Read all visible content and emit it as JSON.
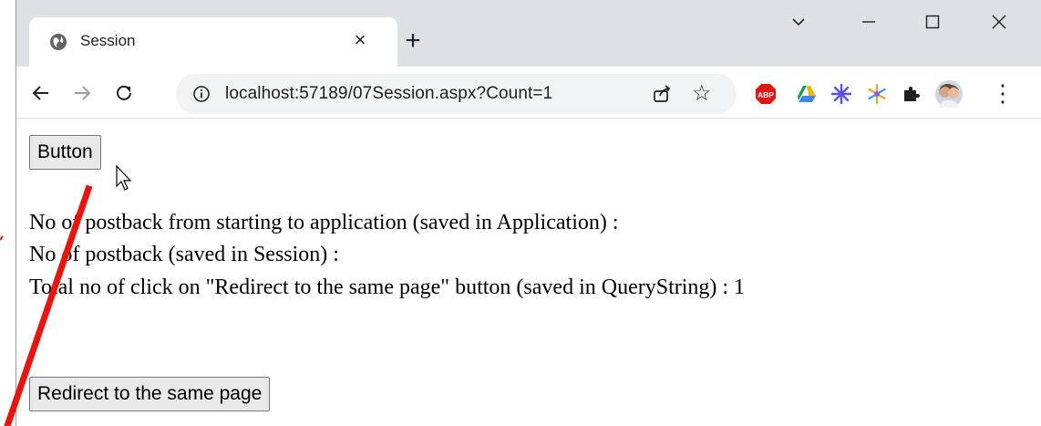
{
  "browser": {
    "tab_title": "Session",
    "tab_close": "×",
    "new_tab": "+",
    "url": "localhost:57189/07Session.aspx?Count=1",
    "controls": {
      "minimize": "–",
      "maximize": "☐",
      "close": "✕",
      "dropdown": "⌵"
    },
    "menu": "⋮",
    "extensions": [
      "adblock-plus-icon",
      "google-drive-icon",
      "extension-burst-icon",
      "extension-snowflake-icon",
      "extensions-puzzle-icon",
      "profile-avatar"
    ],
    "abp_label": "ABP"
  },
  "page": {
    "button_label": "Button",
    "lines": [
      "No of postback from starting to application  (saved in Application) :",
      "No of postback (saved in Session) :",
      "Total no of click on \"Redirect to the same page\" button (saved in QueryString) : 1"
    ],
    "redirect_label": "Redirect to the same page"
  },
  "colors": {
    "tabstrip": "#dee1e6",
    "omnibox": "#f1f3f4",
    "annotation": "#e8140f"
  }
}
